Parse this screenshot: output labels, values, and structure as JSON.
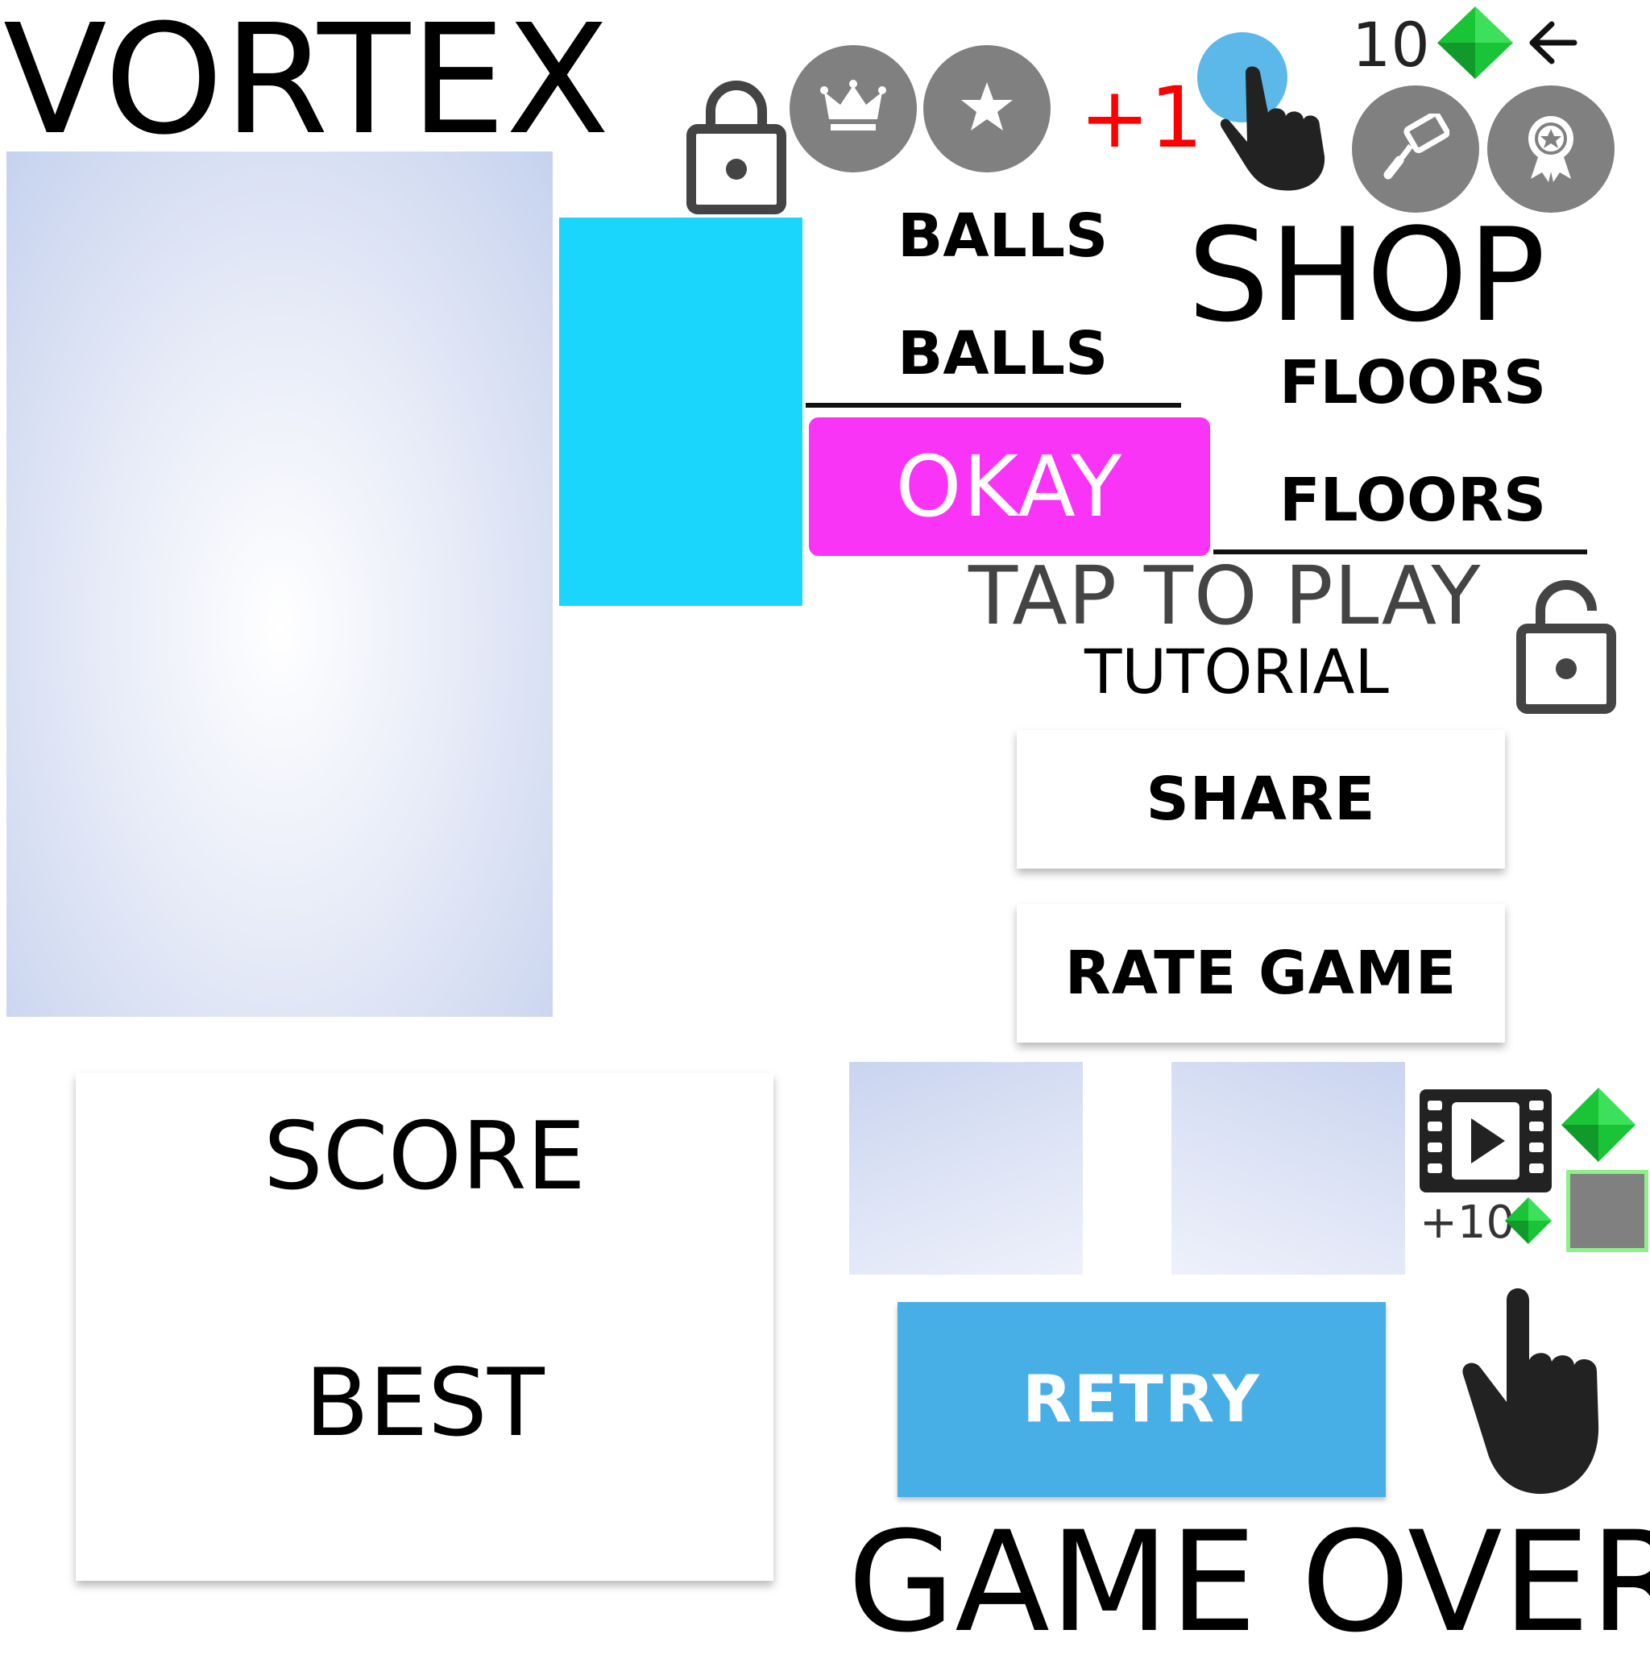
{
  "title": "VORTEX",
  "counter": {
    "gem_count": "10",
    "plus_one": "+1"
  },
  "menu": {
    "balls_1": "BALLS",
    "balls_2": "BALLS",
    "floors_1": "FLOORS",
    "floors_2": "FLOORS"
  },
  "shop": {
    "title": "SHOP"
  },
  "buttons": {
    "okay": "OKAY",
    "share": "SHARE",
    "rate_game": "RATE GAME",
    "retry": "RETRY"
  },
  "start": {
    "tap_to_play": "TAP TO PLAY",
    "tutorial": "TUTORIAL"
  },
  "results": {
    "score_label": "SCORE",
    "best_label": "BEST",
    "game_over": "GAME OVER"
  },
  "reward": {
    "video_reward": "+10"
  },
  "icons": {
    "lock": "lock-icon",
    "crown": "crown-icon",
    "star": "star-icon",
    "tap_hand": "tap-hand-icon",
    "paint_roller": "paint-roller-icon",
    "award": "award-ribbon-icon",
    "gem": "gem-icon",
    "back": "back-arrow-icon",
    "video": "film-play-icon"
  },
  "colors": {
    "cyan_bar": "#1ad6fd",
    "okay": "#f934f7",
    "retry": "#47aee6",
    "plus_one": "#ff0000",
    "gem": "#19c436",
    "circle_button": "#808080"
  }
}
